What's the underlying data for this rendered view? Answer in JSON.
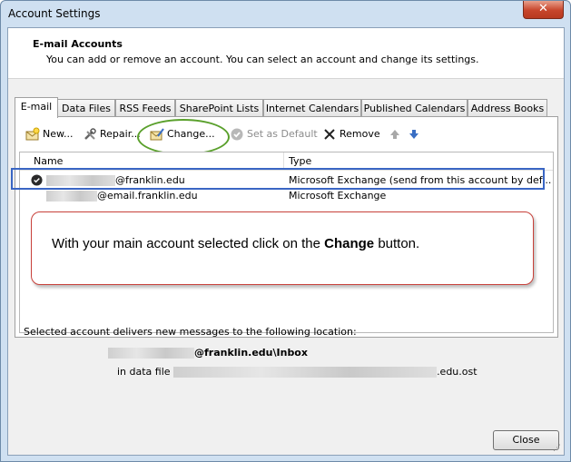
{
  "window": {
    "title": "Account Settings",
    "close_glyph": "✕"
  },
  "header": {
    "title": "E-mail Accounts",
    "subtitle": "You can add or remove an account. You can select an account and change its settings."
  },
  "tabs": [
    {
      "label": "E-mail",
      "active": true
    },
    {
      "label": "Data Files"
    },
    {
      "label": "RSS Feeds"
    },
    {
      "label": "SharePoint Lists"
    },
    {
      "label": "Internet Calendars"
    },
    {
      "label": "Published Calendars"
    },
    {
      "label": "Address Books"
    }
  ],
  "toolbar": {
    "new": "New...",
    "repair": "Repair...",
    "change": "Change...",
    "set_default": "Set as Default",
    "remove": "Remove"
  },
  "list": {
    "col_name": "Name",
    "col_type": "Type",
    "rows": [
      {
        "name_suffix": "@franklin.edu",
        "type": "Microsoft Exchange (send from this account by def...",
        "selected": true
      },
      {
        "name_suffix": "@email.franklin.edu",
        "type": "Microsoft Exchange"
      }
    ]
  },
  "callout": {
    "before": "With your main account selected click on the ",
    "bold": "Change",
    "after": " button."
  },
  "delivery": {
    "label": "Selected account delivers new messages to the following location:",
    "location_suffix": "@franklin.edu\\Inbox",
    "datafile_prefix": "in data file",
    "datafile_suffix": ".edu.ost"
  },
  "footer": {
    "close": "Close"
  },
  "colors": {
    "accent_green": "#5aa02c",
    "accent_blue": "#3a66c4",
    "accent_red": "#c8413a"
  }
}
